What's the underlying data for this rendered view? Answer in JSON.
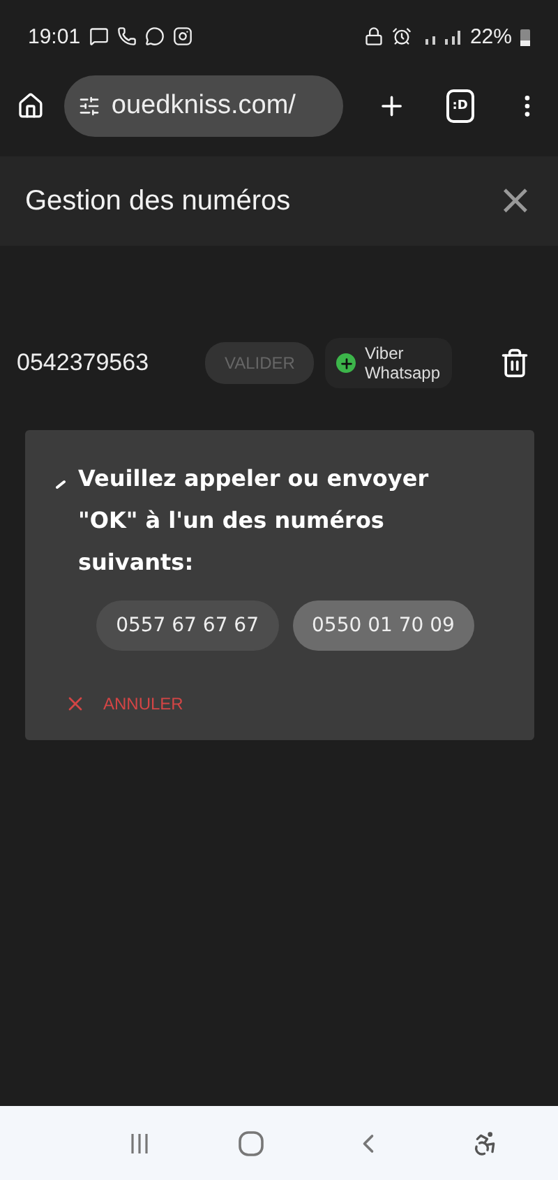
{
  "status_bar": {
    "time": "19:01",
    "battery": "22%"
  },
  "browser": {
    "url": "ouedkniss.com/",
    "tab_label": ":D"
  },
  "dialog_header": {
    "title": "Gestion des numéros",
    "close": "×"
  },
  "phone_row": {
    "number": "0542379563",
    "validate": {
      "label": "VALIDER",
      "disabled": true
    },
    "apps": [
      "Viber",
      "Whatsapp"
    ]
  },
  "confirm_card": {
    "message": "Veuillez appeler ou envoyer \"OK\" à l'un des numéros suivants:",
    "numbers": [
      {
        "label": "0557 67 67 67",
        "selected": false
      },
      {
        "label": "0550 01 70 09",
        "selected": true
      }
    ],
    "cancel": "ANNULER"
  }
}
